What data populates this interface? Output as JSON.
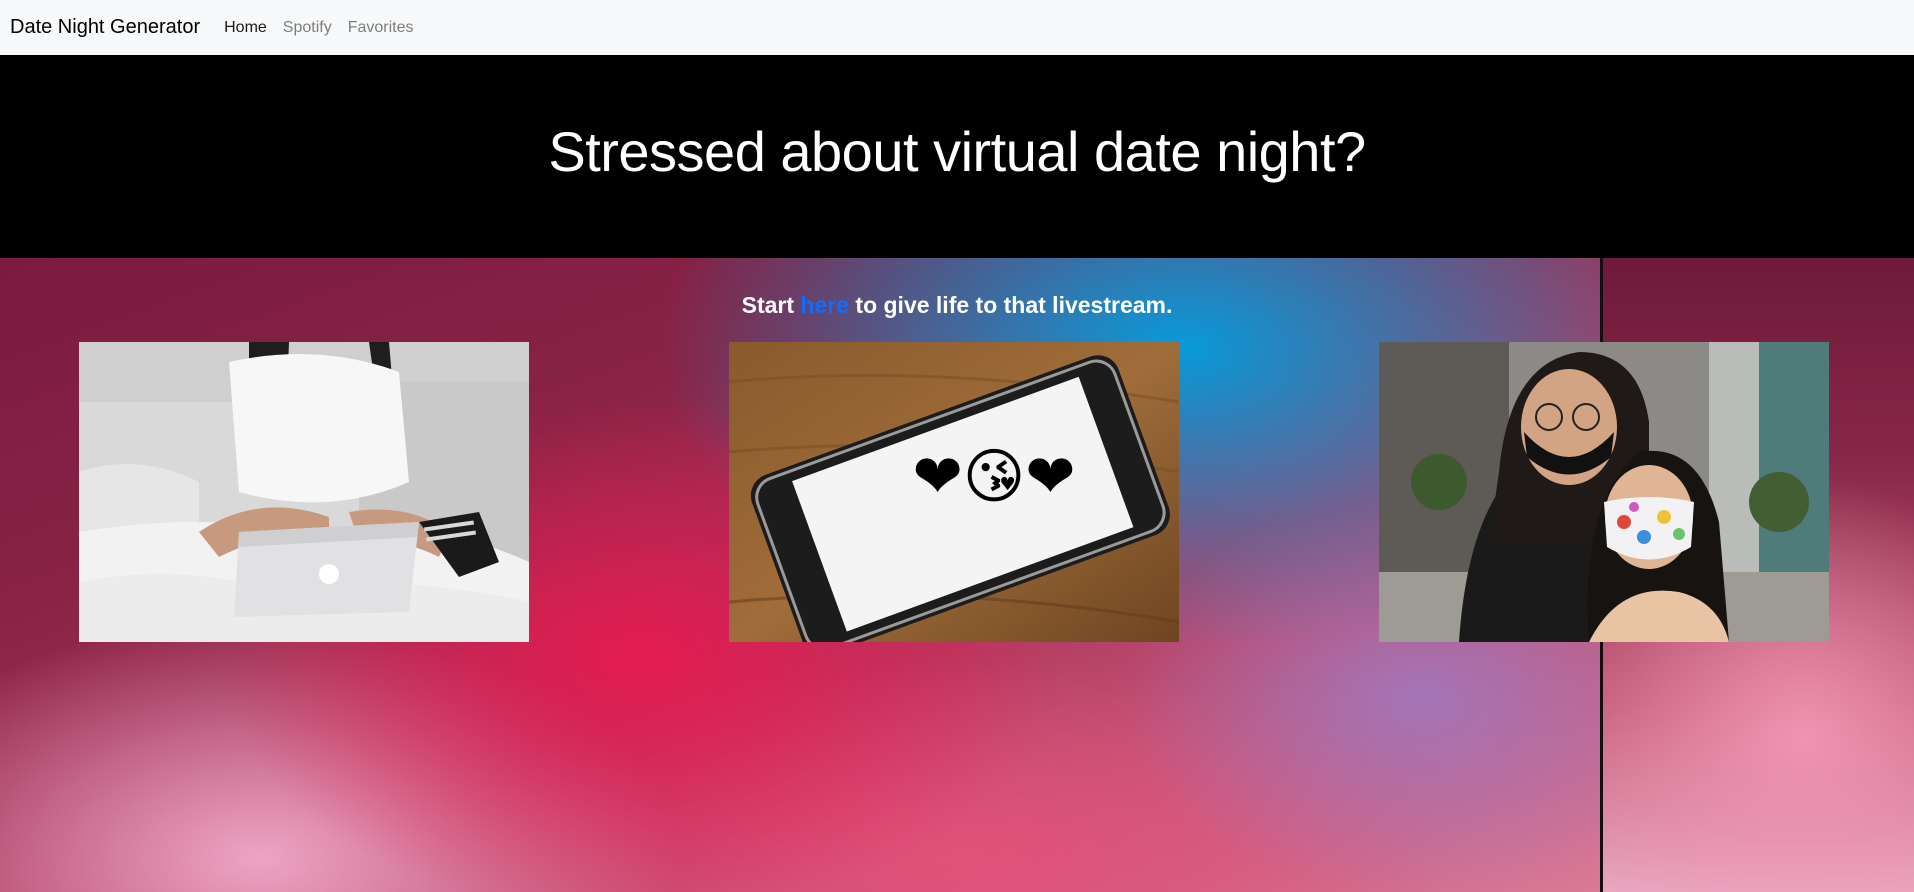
{
  "navbar": {
    "brand": "Date Night Generator",
    "links": [
      {
        "label": "Home",
        "active": true
      },
      {
        "label": "Spotify",
        "active": false
      },
      {
        "label": "Favorites",
        "active": false
      }
    ]
  },
  "hero": {
    "title": "Stressed about virtual date night?"
  },
  "cta": {
    "before": "Start",
    "link": "here",
    "after": "to give life to that livestream."
  },
  "photos": [
    {
      "icon": "woman-with-laptop-photo"
    },
    {
      "icon": "phone-with-emojis-photo",
      "emojis": "❤😘❤"
    },
    {
      "icon": "couple-in-masks-photo"
    }
  ],
  "colors": {
    "navbar_bg": "#f8f9fa",
    "hero_bg": "#000000",
    "link_blue": "#0d6efd",
    "wallpaper_pink": "#e81a50",
    "wallpaper_blue": "#00a0e1"
  }
}
